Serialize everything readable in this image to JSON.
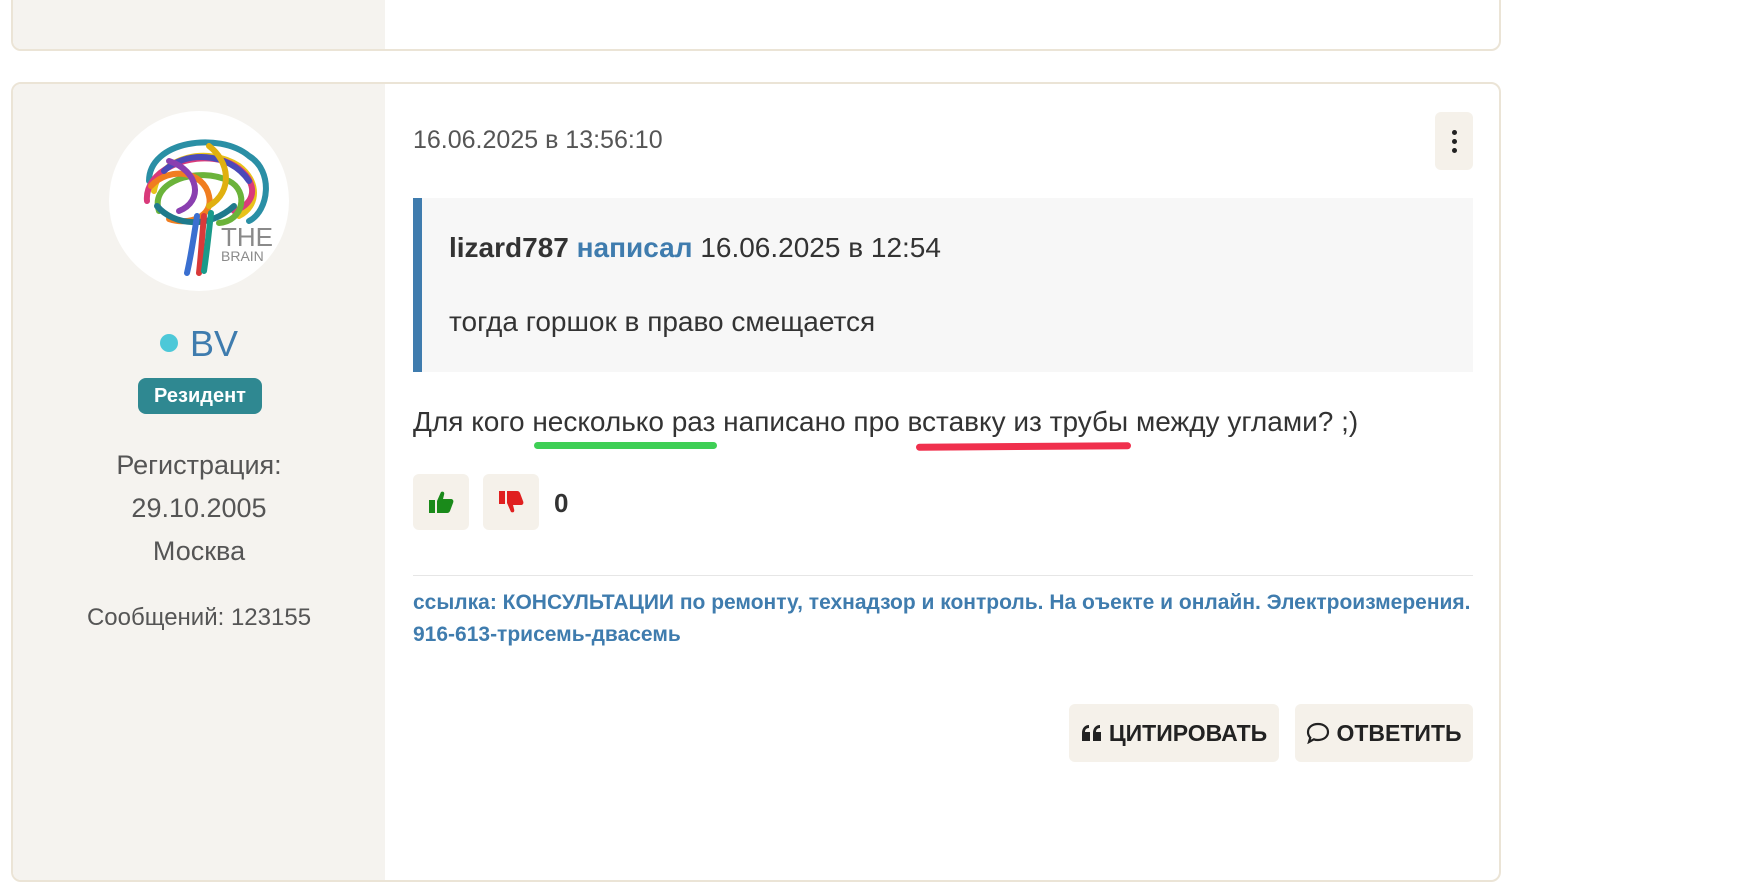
{
  "post": {
    "author": {
      "name": "BV",
      "rank": "Резидент",
      "registration_label": "Регистрация:",
      "registration_date": "29.10.2005",
      "city": "Москва",
      "messages": "Сообщений: 123155",
      "avatar_text_1": "THE",
      "avatar_text_2": "BRAIN"
    },
    "date": "16.06.2025 в 13:56:10",
    "quote": {
      "author": "lizard787",
      "wrote": "написал",
      "date": "16.06.2025 в 12:54",
      "text": "тогда горшок в право смещается"
    },
    "message": {
      "part1": "Для кого ",
      "highlight_green": "несколько раз",
      "part2": " написано про ",
      "highlight_red": "вставку из трубы",
      "part3": " между углами? ;)"
    },
    "score": "0",
    "signature": "ссылка: КОНСУЛЬТАЦИИ по ремонту, технадзор и контроль. На оъекте и онлайн. Электроизмерения. 916-613-трисемь-двасемь",
    "actions": {
      "quote_label": "ЦИТИРОВАТЬ",
      "reply_label": "ОТВЕТИТЬ"
    }
  },
  "colors": {
    "accent": "#3f7cae",
    "badge": "#2f8891",
    "online": "#4dc8d8",
    "like": "#1a8a1a",
    "dislike": "#e02020",
    "underline_green": "#3ecf55",
    "underline_red": "#f0304d"
  },
  "icons": [
    "thumbs-up-icon",
    "thumbs-down-icon",
    "quote-icon",
    "comment-icon",
    "kebab-menu-icon",
    "brain-avatar"
  ]
}
